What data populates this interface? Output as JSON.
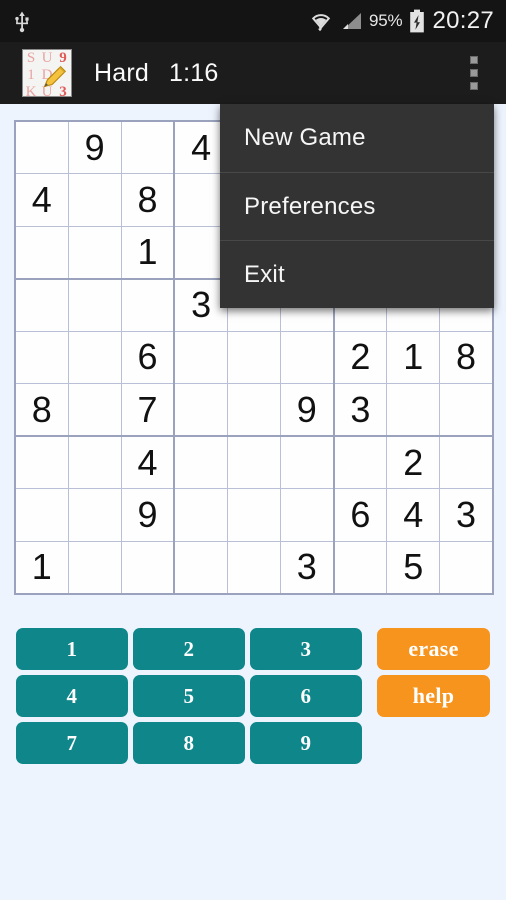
{
  "status_bar": {
    "usb_icon": "usb-icon",
    "wifi_icon": "wifi-icon",
    "signal_icon": "cellular-signal-icon",
    "battery_percent": "95%",
    "battery_icon": "battery-charging-icon",
    "clock": "20:27"
  },
  "action_bar": {
    "app_icon": "sudoku-app-icon",
    "icon_glyphs": [
      "S",
      "U",
      "9",
      "1",
      "D",
      "",
      "K",
      "U",
      "3"
    ],
    "difficulty": "Hard",
    "timer": "1:16",
    "overflow_icon": "overflow-menu-icon"
  },
  "menu": {
    "items": [
      {
        "label": "New Game",
        "name": "menu-item-new-game"
      },
      {
        "label": "Preferences",
        "name": "menu-item-preferences"
      },
      {
        "label": "Exit",
        "name": "menu-item-exit"
      }
    ]
  },
  "board": {
    "rows": [
      [
        "",
        "9",
        "",
        "4",
        "",
        "",
        "",
        "",
        ""
      ],
      [
        "4",
        "",
        "8",
        "",
        "",
        "",
        "",
        "",
        ""
      ],
      [
        "",
        "",
        "1",
        "",
        "",
        "",
        "",
        "",
        ""
      ],
      [
        "",
        "",
        "",
        "3",
        "",
        "",
        "",
        "",
        ""
      ],
      [
        "",
        "",
        "6",
        "",
        "",
        "",
        "2",
        "1",
        "8"
      ],
      [
        "8",
        "",
        "7",
        "",
        "",
        "9",
        "3",
        "",
        ""
      ],
      [
        "",
        "",
        "4",
        "",
        "",
        "",
        "",
        "2",
        ""
      ],
      [
        "",
        "",
        "9",
        "",
        "",
        "",
        "6",
        "4",
        "3"
      ],
      [
        "1",
        "",
        "",
        "",
        "",
        "3",
        "",
        "5",
        ""
      ]
    ]
  },
  "keypad": {
    "numbers": [
      [
        "1",
        "2",
        "3"
      ],
      [
        "4",
        "5",
        "6"
      ],
      [
        "7",
        "8",
        "9"
      ]
    ],
    "erase_label": "erase",
    "help_label": "help"
  },
  "colors": {
    "teal": "#0e868a",
    "orange": "#f7941e",
    "background": "#eef4fe",
    "action_bar": "#1c1c1c",
    "menu": "#333333",
    "grid_line": "#b9bfd6"
  }
}
